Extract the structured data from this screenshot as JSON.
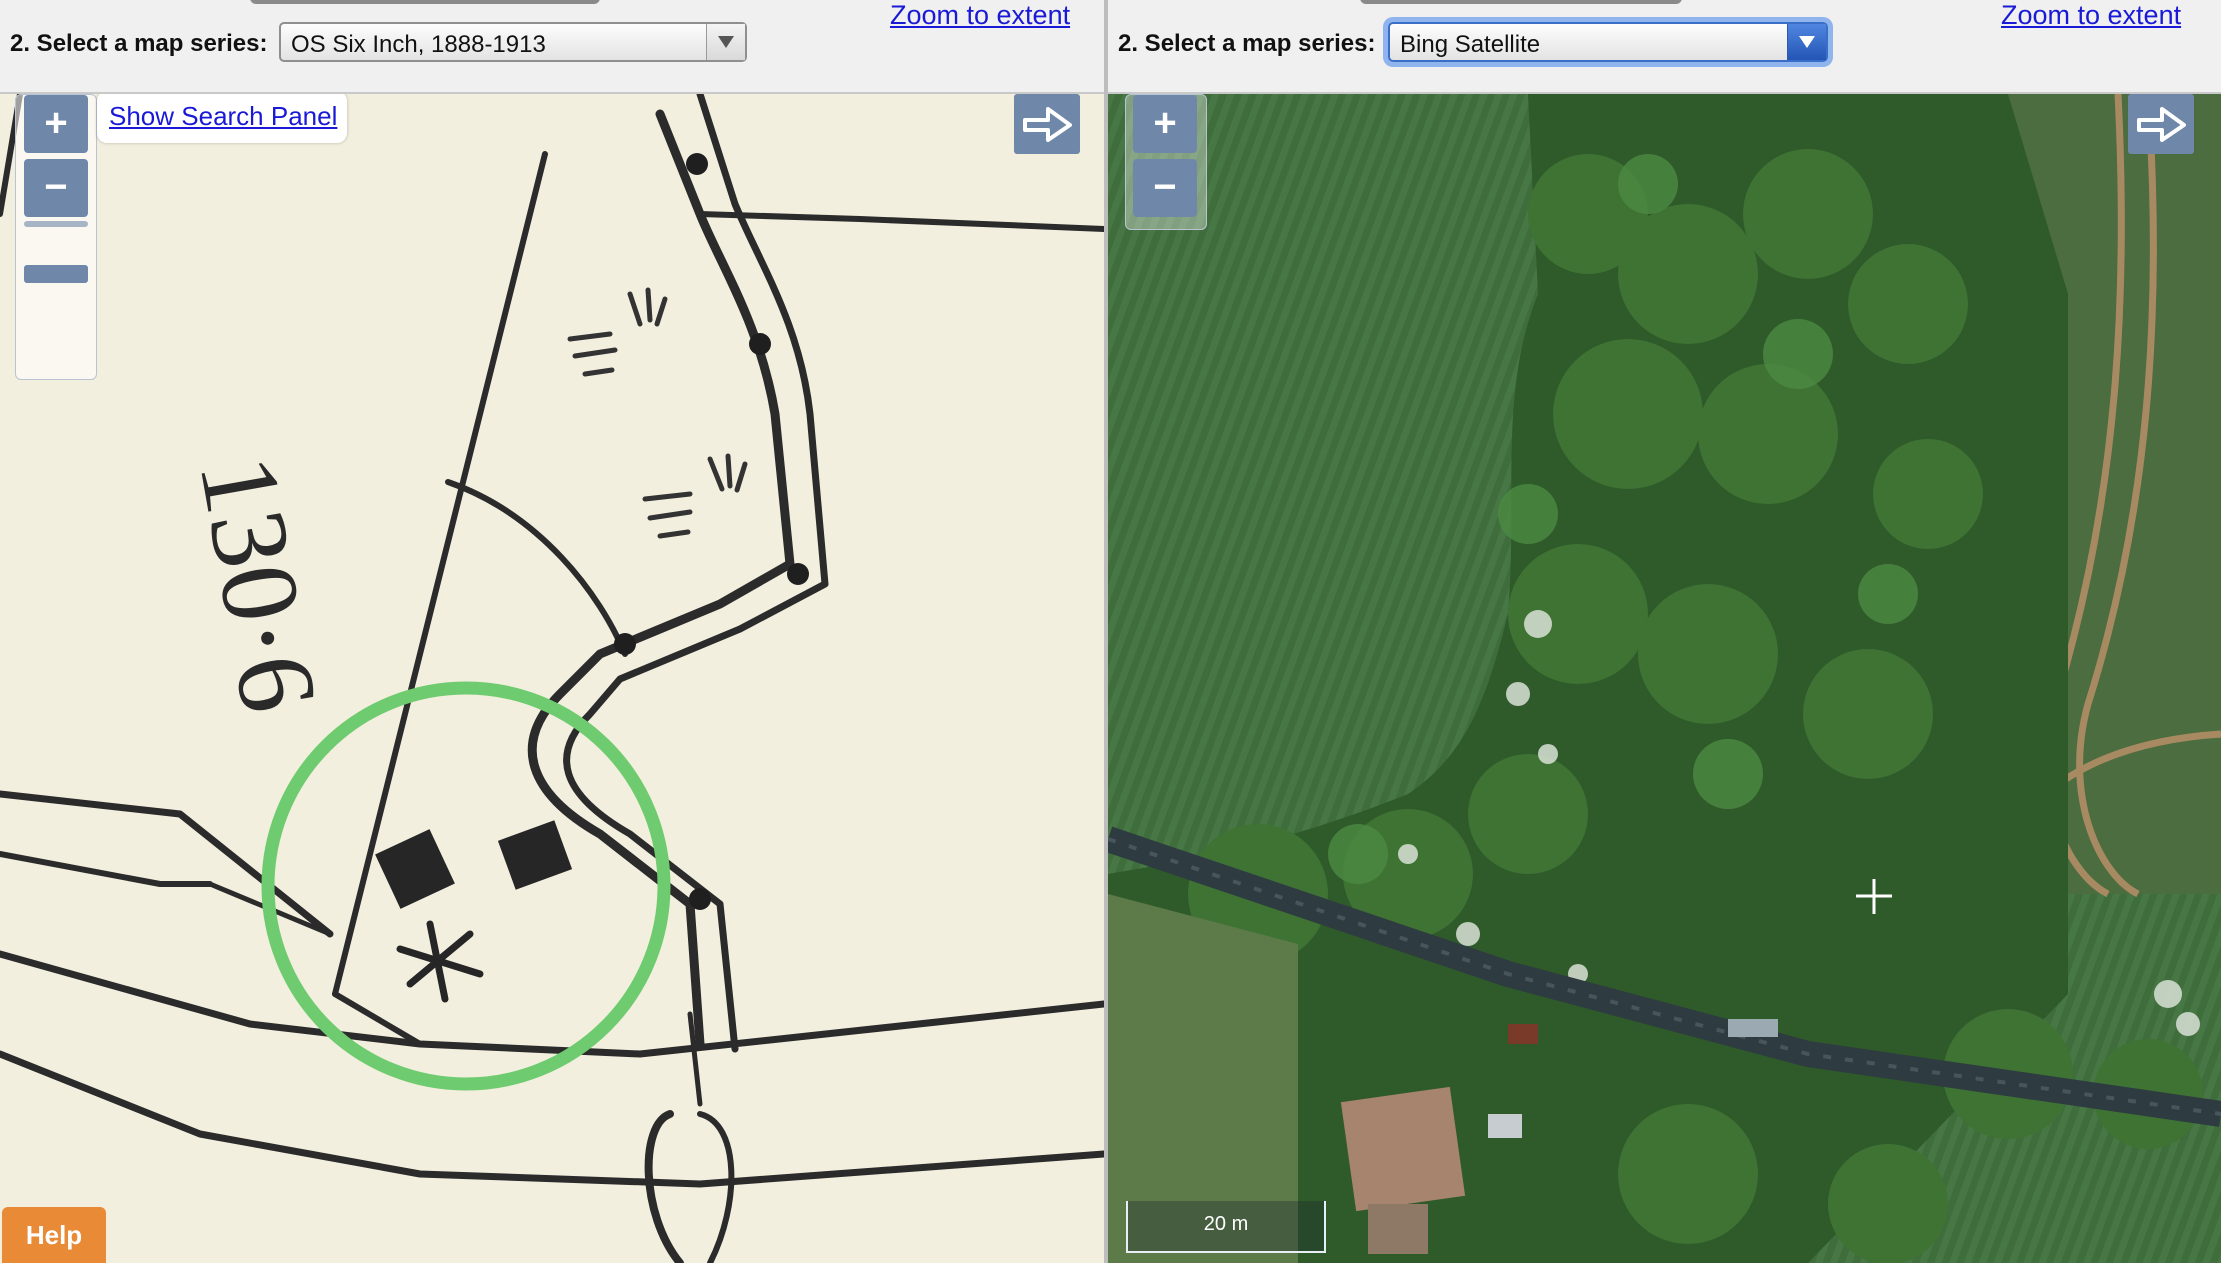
{
  "left": {
    "series_label": "2. Select a map series:",
    "series_value": "OS Six Inch, 1888-1913",
    "zoom_extent": "Zoom to extent",
    "zoom_in": "+",
    "zoom_out": "−",
    "search_panel": "Show Search Panel",
    "map_text": "130·6",
    "help": "Help"
  },
  "right": {
    "series_label": "2. Select a map series:",
    "series_value": "Bing Satellite",
    "zoom_extent": "Zoom to extent",
    "zoom_in": "+",
    "zoom_out": "−",
    "scale": "20 m"
  },
  "icons": {
    "share": "share-arrow-icon",
    "dropdown": "triangle-down-icon",
    "cursor": "crosshair-icon"
  },
  "colors": {
    "highlight_circle": "#6fcb6f",
    "help_button": "#e98a37",
    "link": "#1a1ad6",
    "control": "#6f87a8"
  }
}
